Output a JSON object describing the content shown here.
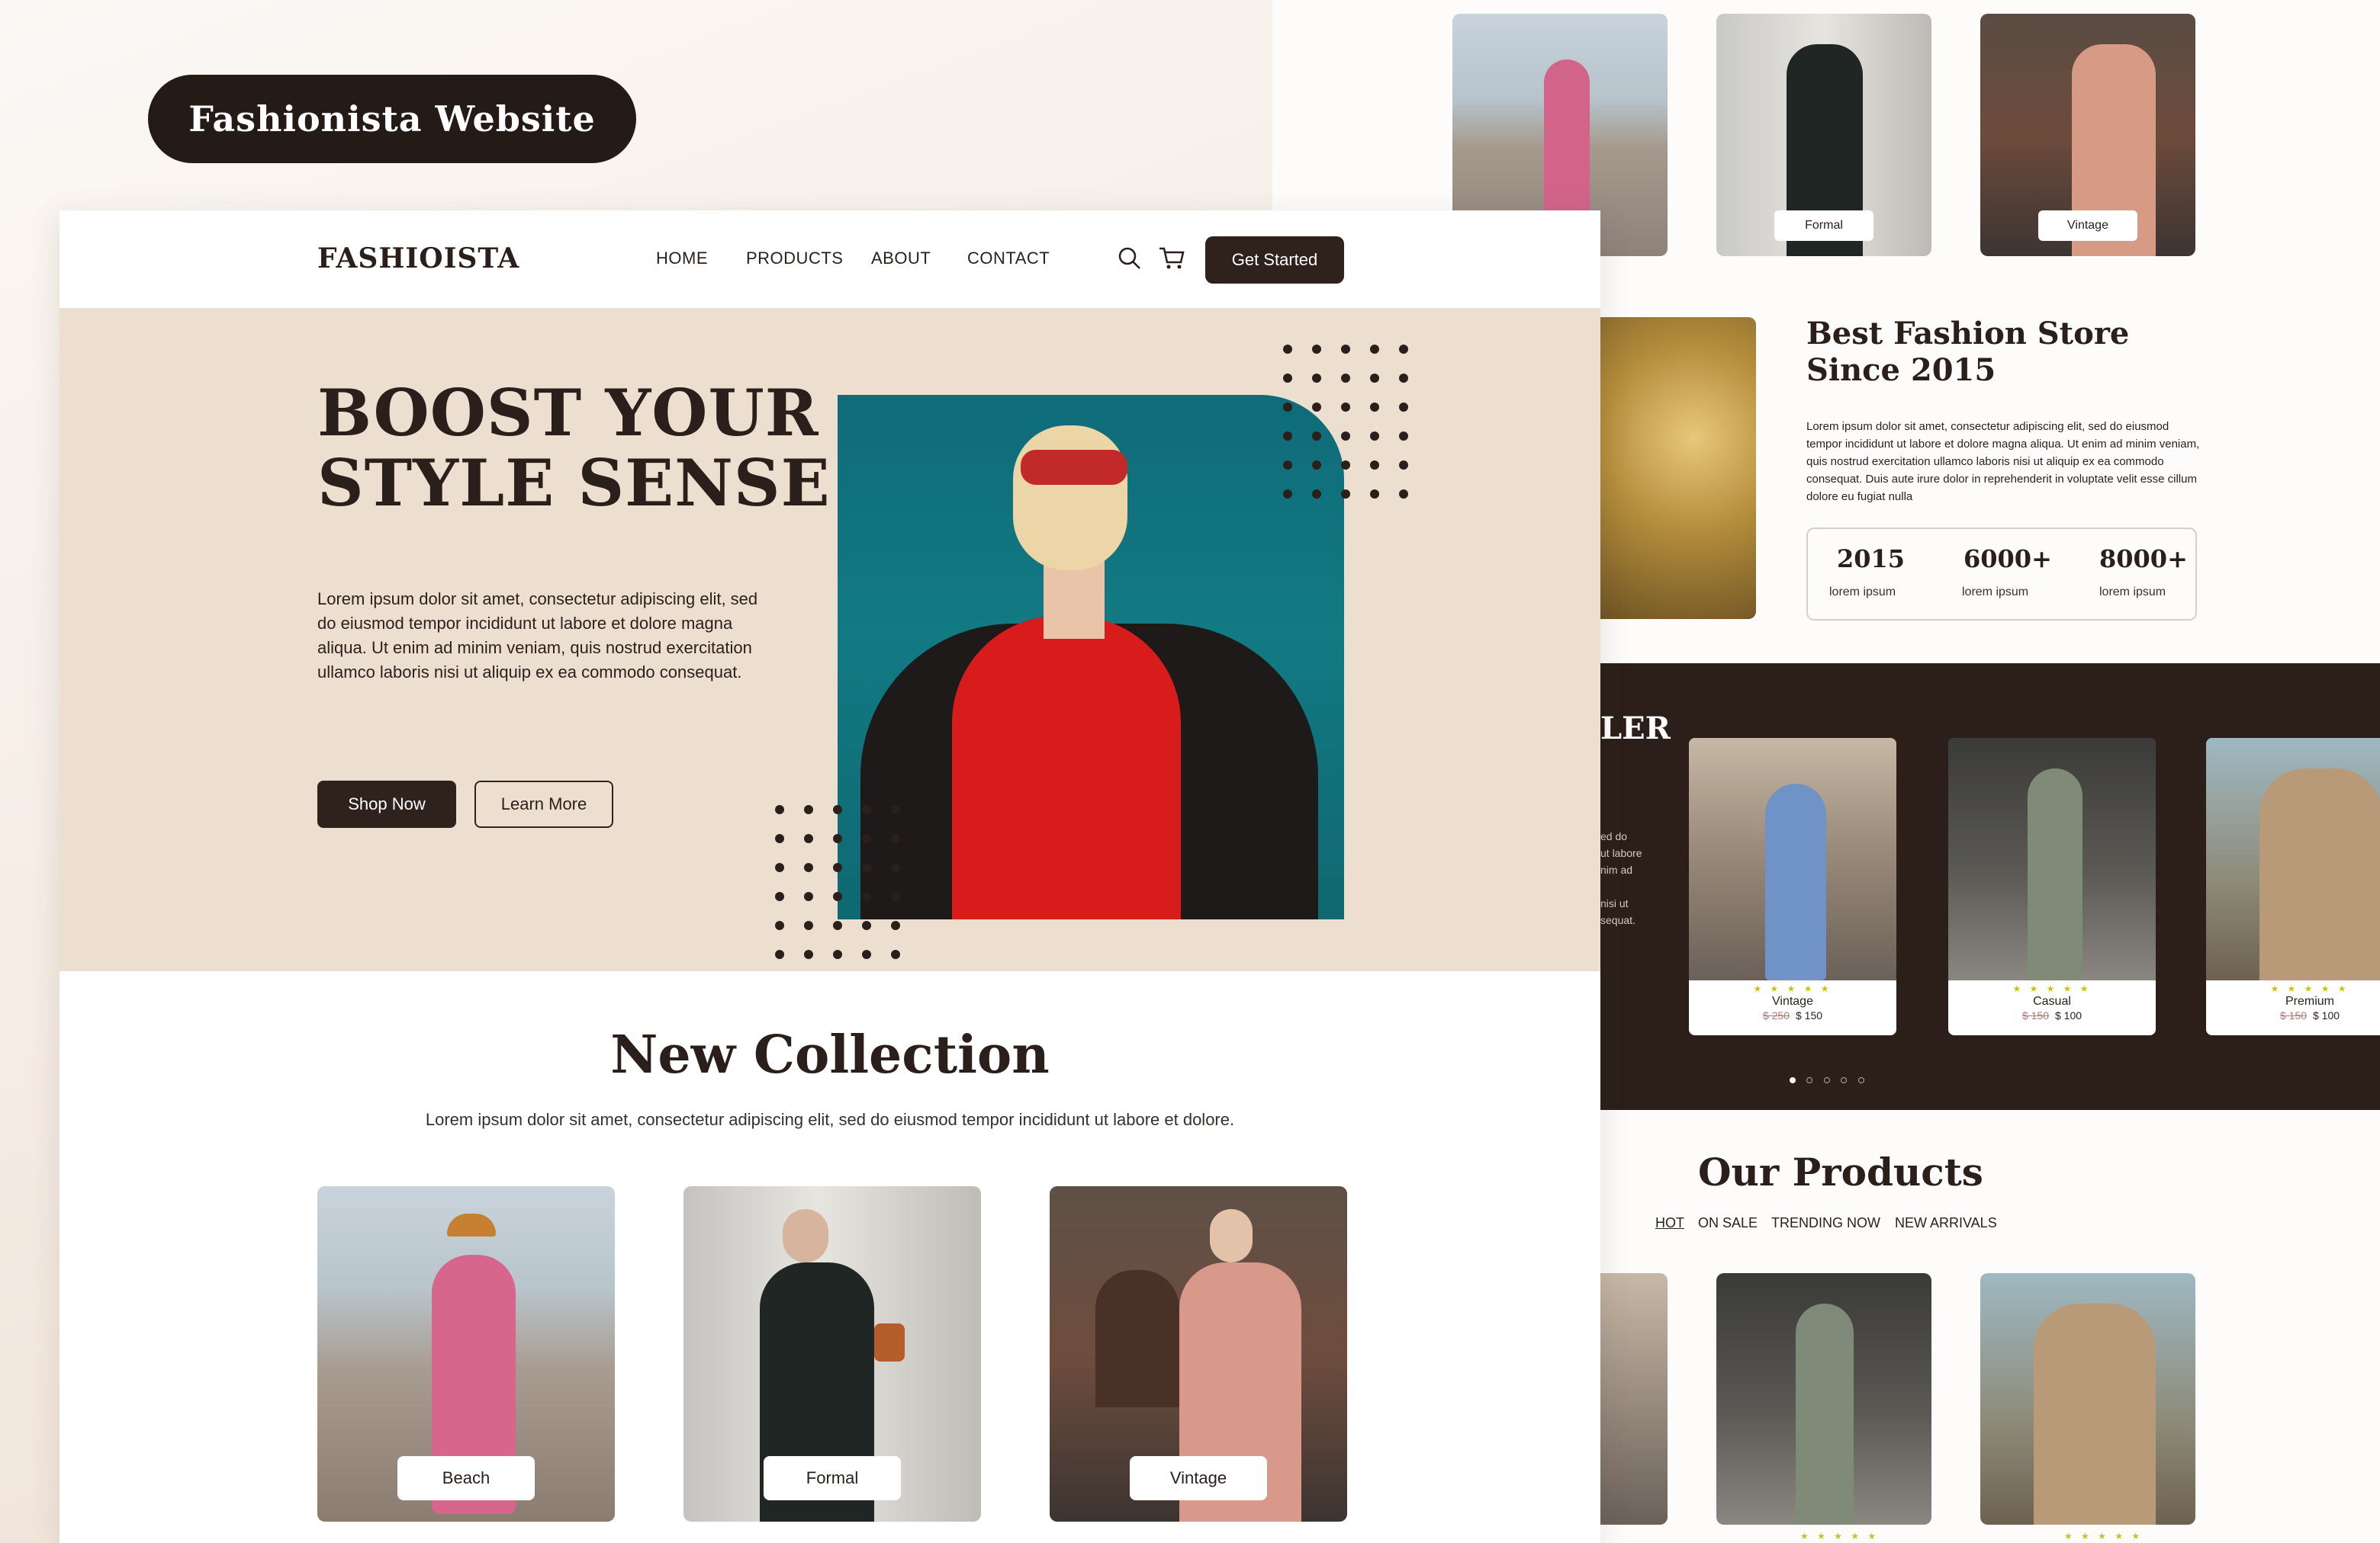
{
  "badge": "Fashionista Website",
  "nav": {
    "logo": "FASHIOISTA",
    "links": [
      "HOME",
      "PRODUCTS",
      "ABOUT",
      "CONTACT"
    ],
    "cta": "Get Started"
  },
  "hero": {
    "title_line1": "BOOST YOUR",
    "title_line2": "STYLE SENSE",
    "body": "Lorem ipsum dolor sit amet, consectetur adipiscing elit, sed do eiusmod tempor incididunt ut labore et dolore magna aliqua. Ut enim ad minim veniam, quis nostrud exercitation ullamco laboris nisi ut aliquip ex ea commodo consequat.",
    "btn_primary": "Shop Now",
    "btn_secondary": "Learn More"
  },
  "collection": {
    "title": "New Collection",
    "subtitle": "Lorem ipsum dolor sit amet, consectetur adipiscing elit, sed do eiusmod tempor incididunt ut labore et dolore.",
    "cards": [
      "Beach",
      "Formal",
      "Vintage"
    ]
  },
  "top_cards": [
    "Formal",
    "Vintage"
  ],
  "about": {
    "title": "Best Fashion Store Since 2015",
    "body": "Lorem ipsum dolor sit amet, consectetur adipiscing elit, sed do eiusmod tempor incididunt ut labore et dolore magna aliqua. Ut enim ad minim veniam, quis nostrud exercitation ullamco laboris nisi ut aliquip ex ea commodo consequat. Duis aute irure dolor in reprehenderit in voluptate velit esse cillum dolore eu fugiat nulla",
    "stats": [
      {
        "num": "2015",
        "label": "lorem ipsum"
      },
      {
        "num": "6000+",
        "label": "lorem ipsum"
      },
      {
        "num": "8000+",
        "label": "lorem ipsum"
      }
    ]
  },
  "bestseller": {
    "title_partial": "LER",
    "body_partial": "ed do\nut labore\nnim ad\n\nnisi ut\nsequat.",
    "rating": "★ ★ ★ ★ ★",
    "cards": [
      {
        "name": "Vintage",
        "old": "$ 250",
        "price": "$ 150"
      },
      {
        "name": "Casual",
        "old": "$ 150",
        "price": "$ 100"
      },
      {
        "name": "Premium",
        "old": "$ 150",
        "price": "$ 100"
      }
    ]
  },
  "products": {
    "title": "Our Products",
    "tabs": [
      "HOT",
      "ON SALE",
      "TRENDING NOW",
      "NEW ARRIVALS"
    ],
    "rating": "★ ★ ★ ★ ★"
  },
  "colors": {
    "dark": "#2f221d",
    "hero_bg": "#eddfd0",
    "band_bg": "#2c1f1a",
    "star": "#c8c21b"
  }
}
